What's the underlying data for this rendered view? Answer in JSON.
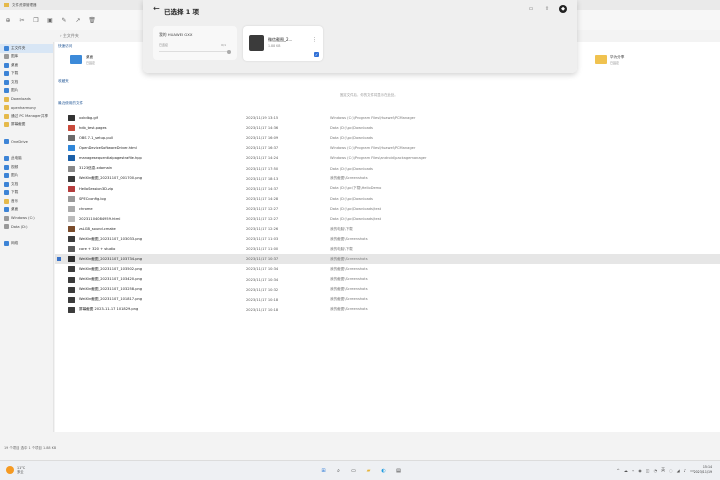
{
  "explorer": {
    "title": "文件资源管理器",
    "breadcrumb": "› 主文件夹",
    "status": "19 个项目   选中 1 个项目   1.88 KB"
  },
  "sidebar": {
    "items": [
      {
        "label": "主文件夹",
        "selected": true
      },
      {
        "label": "图库"
      },
      {
        "label": "桌面"
      },
      {
        "label": "下载"
      },
      {
        "label": "文档"
      },
      {
        "label": "图片"
      },
      {
        "label": "Downloads"
      },
      {
        "label": "openharmony"
      },
      {
        "label": "通过 PC Manager共享"
      },
      {
        "label": "屏幕截图"
      },
      {
        "label": ""
      },
      {
        "label": "OneDrive"
      },
      {
        "label": ""
      },
      {
        "label": "此电脑"
      },
      {
        "label": "视频"
      },
      {
        "label": "图片"
      },
      {
        "label": "文档"
      },
      {
        "label": "下载"
      },
      {
        "label": "音乐"
      },
      {
        "label": "桌面"
      },
      {
        "label": "Windows (C:)"
      },
      {
        "label": "Data (D:)"
      },
      {
        "label": ""
      },
      {
        "label": "网络"
      }
    ]
  },
  "main": {
    "quick_label": "快速访问",
    "fav_label": "收藏夹",
    "recent_label": "最近使用的文件",
    "quick_left": {
      "name": "桌面",
      "sub": "已固定"
    },
    "quick_right": {
      "name": "华为分享",
      "sub": "已固定"
    },
    "empty_note": "固定文件后，你的文件将显示在此处。",
    "files": [
      {
        "name": "xxkdbg.gif",
        "date": "2023/11/19 13:15",
        "loc": "Windows (C:)\\Program Files\\Huawei\\PCManager",
        "icon": "#333333"
      },
      {
        "name": "hdb_test.pages",
        "date": "2023/11/17 14:36",
        "loc": "Data (D:)\\pc\\Downloads",
        "icon": "#c94a3b"
      },
      {
        "name": "OBS 7.1_setup.pull",
        "date": "2023/11/17 16:09",
        "loc": "Data (D:)\\pc\\Downloads",
        "icon": "#6a6a6a"
      },
      {
        "name": "OpenDeviceSoftwareDriver.html",
        "date": "2023/11/17 16:37",
        "loc": "Windows (C:)\\Program Files\\Huawei\\PCManager",
        "icon": "#2f86d9"
      },
      {
        "name": "managesequentialpagestrafile.hpp",
        "date": "2023/11/17 14:24",
        "loc": "Windows (C:)\\Program Files\\android\\packagemanager",
        "icon": "#1b5fa8"
      },
      {
        "name": "3123信息.xdomain",
        "date": "2023/11/17 17:50",
        "loc": "Data (D:)\\pc\\Downloads",
        "icon": "#888888"
      },
      {
        "name": "WeiXin截图_20231107_001700.png",
        "date": "2023/11/17 18:13",
        "loc": "我的截图\\Screenshots",
        "icon": "#3c3c3c"
      },
      {
        "name": "HelloSession3D.zip",
        "date": "2023/11/17 14:37",
        "loc": "Data (D:)\\pc\\下载\\HelloDemo",
        "icon": "#b43c3c"
      },
      {
        "name": "SPECconfig.log",
        "date": "2023/11/17 14:28",
        "loc": "Data (D:)\\pc\\Downloads",
        "icon": "#999999"
      },
      {
        "name": "chrome",
        "date": "2023/11/17 12:27",
        "loc": "Data (D:)\\pc\\Downloads\\test",
        "icon": "#aaaaaa"
      },
      {
        "name": "20231104084959.html",
        "date": "2023/11/17 12:27",
        "loc": "Data (D:)\\pc\\Downloads\\test",
        "icon": "#bbbbbb"
      },
      {
        "name": "zsLGB_sound.cmake",
        "date": "2023/11/17 12:26",
        "loc": "我的电脑\\下载",
        "icon": "#7a4b2a"
      },
      {
        "name": "WeiXin截图_20231107_103033.png",
        "date": "2023/11/17 11:03",
        "loc": "我的截图\\Screenshots",
        "icon": "#3c3c3c"
      },
      {
        "name": "core + 320 + studio",
        "date": "2023/11/17 11:00",
        "loc": "我的电脑\\下载",
        "icon": "#5a5a5a"
      },
      {
        "name": "WeiXin截图_20231107_103734.png",
        "date": "2023/11/17 10:37",
        "loc": "我的截图\\Screenshots",
        "icon": "#2d2d2d",
        "selected": true
      },
      {
        "name": "WeiXin截图_20231107_103502.png",
        "date": "2023/11/17 10:34",
        "loc": "我的截图\\Screenshots",
        "icon": "#3c3c3c"
      },
      {
        "name": "WeiXin截图_20231107_103420.png",
        "date": "2023/11/17 10:34",
        "loc": "我的截图\\Screenshots",
        "icon": "#3c3c3c"
      },
      {
        "name": "WeiXin截图_20231107_103258.png",
        "date": "2023/11/17 10:32",
        "loc": "我的截图\\Screenshots",
        "icon": "#3c3c3c"
      },
      {
        "name": "WeiXin截图_20231107_101817.png",
        "date": "2023/11/17 10:18",
        "loc": "我的截图\\Screenshots",
        "icon": "#3c3c3c"
      },
      {
        "name": "屏幕截图 2023-11-17 101829.png",
        "date": "2023/11/17 10:18",
        "loc": "我的截图\\Screenshots",
        "icon": "#3c3c3c"
      }
    ]
  },
  "overlay": {
    "back": "←",
    "title": "已选择 1 项",
    "icons": [
      "folder-icon",
      "upload-icon",
      "share-icon"
    ],
    "device_name": "我的 HUAWEI GXX",
    "device_status": "已连接",
    "device_ratio": "0/1",
    "device_progress": 0,
    "file_name": "微信截图_2...",
    "file_size": "1.88 KB",
    "more": "⋮",
    "check": "✓"
  },
  "taskbar": {
    "weather_temp": "11°C",
    "weather_desc": "多云",
    "apps": [
      {
        "name": "windows-start-icon",
        "glyph": "⊞",
        "color": "#2b79d8"
      },
      {
        "name": "search-icon",
        "glyph": "⌕",
        "color": "#333333"
      },
      {
        "name": "task-view-icon",
        "glyph": "▭",
        "color": "#333333"
      },
      {
        "name": "file-explorer-icon",
        "glyph": "▰",
        "color": "#e7b43b"
      },
      {
        "name": "edge-icon",
        "glyph": "◐",
        "color": "#1e9be0"
      },
      {
        "name": "terminal-icon",
        "glyph": "▤",
        "color": "#2c2c2c"
      }
    ],
    "tray": [
      "^",
      "☁",
      "⌁",
      "◉",
      "◫",
      "◔",
      "英",
      "◌",
      "◢",
      "♪",
      "▭"
    ],
    "time": "15:14",
    "date": "2023/11/19"
  }
}
